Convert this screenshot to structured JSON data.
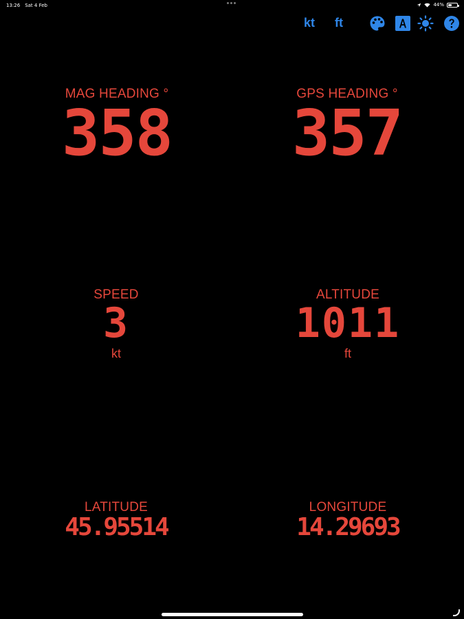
{
  "status_bar": {
    "time": "13:26",
    "date": "Sat 4 Feb",
    "battery_text": "44%",
    "battery_level": 0.44
  },
  "toolbar": {
    "speed_unit_label": "kt",
    "altitude_unit_label": "ft",
    "icons": [
      "palette-icon",
      "font-icon",
      "brightness-icon",
      "help-icon"
    ],
    "accent_color": "#2f86e8"
  },
  "theme": {
    "display_color": "#e5473b",
    "background": "#000000"
  },
  "gauges": {
    "mag_heading": {
      "label": "MAG HEADING °",
      "value": "358"
    },
    "gps_heading": {
      "label": "GPS HEADING °",
      "value": "357"
    },
    "speed": {
      "label": "SPEED",
      "value": "3",
      "unit": "kt"
    },
    "altitude": {
      "label": "ALTITUDE",
      "value": "1011",
      "unit": "ft"
    },
    "latitude": {
      "label": "LATITUDE",
      "value": "45.95514"
    },
    "longitude": {
      "label": "LONGITUDE",
      "value": "14.29693"
    }
  }
}
